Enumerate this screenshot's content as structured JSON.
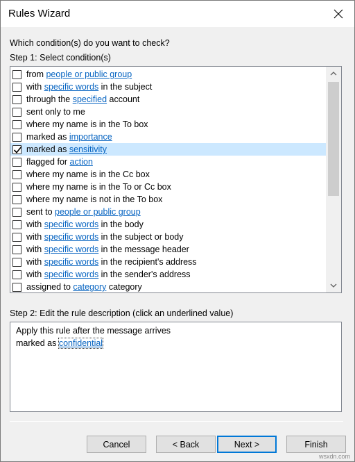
{
  "window": {
    "title": "Rules Wizard"
  },
  "question": "Which condition(s) do you want to check?",
  "step1_label": "Step 1: Select condition(s)",
  "conditions": [
    {
      "checked": false,
      "parts": [
        {
          "t": "from "
        },
        {
          "t": "people or public group",
          "link": true
        }
      ]
    },
    {
      "checked": false,
      "parts": [
        {
          "t": "with "
        },
        {
          "t": "specific words",
          "link": true
        },
        {
          "t": " in the subject"
        }
      ]
    },
    {
      "checked": false,
      "parts": [
        {
          "t": "through the "
        },
        {
          "t": "specified",
          "link": true
        },
        {
          "t": " account"
        }
      ]
    },
    {
      "checked": false,
      "parts": [
        {
          "t": "sent only to me"
        }
      ]
    },
    {
      "checked": false,
      "parts": [
        {
          "t": "where my name is in the To box"
        }
      ]
    },
    {
      "checked": false,
      "parts": [
        {
          "t": "marked as "
        },
        {
          "t": "importance",
          "link": true
        }
      ]
    },
    {
      "checked": true,
      "selected": true,
      "parts": [
        {
          "t": "marked as "
        },
        {
          "t": "sensitivity",
          "link": true
        }
      ]
    },
    {
      "checked": false,
      "parts": [
        {
          "t": "flagged for "
        },
        {
          "t": "action",
          "link": true
        }
      ]
    },
    {
      "checked": false,
      "parts": [
        {
          "t": "where my name is in the Cc box"
        }
      ]
    },
    {
      "checked": false,
      "parts": [
        {
          "t": "where my name is in the To or Cc box"
        }
      ]
    },
    {
      "checked": false,
      "parts": [
        {
          "t": "where my name is not in the To box"
        }
      ]
    },
    {
      "checked": false,
      "parts": [
        {
          "t": "sent to "
        },
        {
          "t": "people or public group",
          "link": true
        }
      ]
    },
    {
      "checked": false,
      "parts": [
        {
          "t": "with "
        },
        {
          "t": "specific words",
          "link": true
        },
        {
          "t": " in the body"
        }
      ]
    },
    {
      "checked": false,
      "parts": [
        {
          "t": "with "
        },
        {
          "t": "specific words",
          "link": true
        },
        {
          "t": " in the subject or body"
        }
      ]
    },
    {
      "checked": false,
      "parts": [
        {
          "t": "with "
        },
        {
          "t": "specific words",
          "link": true
        },
        {
          "t": " in the message header"
        }
      ]
    },
    {
      "checked": false,
      "parts": [
        {
          "t": "with "
        },
        {
          "t": "specific words",
          "link": true
        },
        {
          "t": " in the recipient's address"
        }
      ]
    },
    {
      "checked": false,
      "parts": [
        {
          "t": "with "
        },
        {
          "t": "specific words",
          "link": true
        },
        {
          "t": " in the sender's address"
        }
      ]
    },
    {
      "checked": false,
      "parts": [
        {
          "t": "assigned to "
        },
        {
          "t": "category",
          "link": true
        },
        {
          "t": " category"
        }
      ]
    }
  ],
  "step2_label": "Step 2: Edit the rule description (click an underlined value)",
  "description": {
    "line1": "Apply this rule after the message arrives",
    "line2_prefix": "marked as ",
    "line2_link": "confidential"
  },
  "buttons": {
    "cancel": "Cancel",
    "back": "< Back",
    "next": "Next >",
    "finish": "Finish"
  },
  "watermark": "wsxdn.com",
  "colors": {
    "link": "#0563c1",
    "selection": "#cce8ff",
    "default_button_border": "#0078d7"
  }
}
